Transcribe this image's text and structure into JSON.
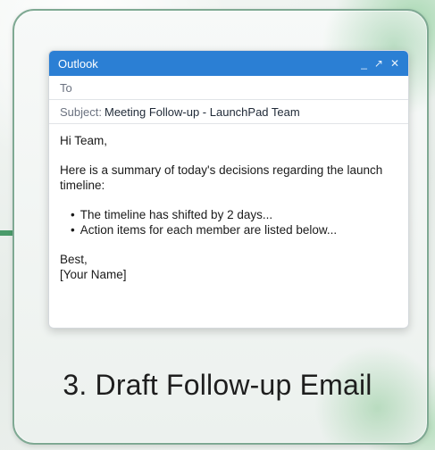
{
  "window": {
    "title": "Outlook",
    "controls": {
      "minimize": "_",
      "maximize": "↗",
      "close": "✕"
    }
  },
  "compose": {
    "to_label": "To",
    "subject_label": "Subject:",
    "subject_value": "Meeting Follow-up - LaunchPad Team",
    "greeting": "Hi Team,",
    "intro": "Here is a summary of today's decisions regarding the launch timeline:",
    "bullets": [
      "The timeline has shifted by 2 days...",
      "Action items for each member are listed below..."
    ],
    "signoff": "Best,",
    "signature": "[Your Name]"
  },
  "caption": "3. Draft Follow-up Email",
  "colors": {
    "titlebar": "#2b7fd4",
    "accent_green": "#4a9b6a"
  }
}
